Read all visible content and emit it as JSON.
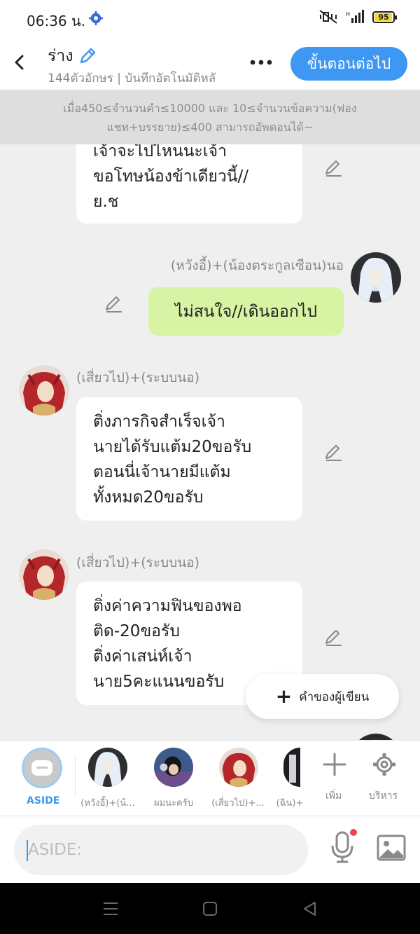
{
  "status_bar": {
    "time": "06:36 น.",
    "battery": "95",
    "battery_level": 0.95
  },
  "header": {
    "title": "ร่าง",
    "subtitle": "144ตัวอักษร | บันทึกอัตโนมัติหลั",
    "next_button": "ขั้นตอนต่อไป"
  },
  "notice": {
    "line1": "เมื่อ450≤จำนวนคำ≤10000 และ 10≤จำนวนข้อความ(ฟอง",
    "line2": "แชท+บรรยาย)≤400 สามารถอัพตอนได้~"
  },
  "messages": [
    {
      "lines": [
        "เจ้าจะไปไหนนะเจ้า",
        "ขอโทษน้องข้าเดียวนี้//",
        "ย.ช"
      ]
    },
    {
      "name": "(หวังอี้)+(น้องตระกูลเซือน)นอ",
      "text": "ไม่สนใจ//เดินออกไป"
    },
    {
      "name": "(เสี่ยวไป)+(ระบบนอ)",
      "lines": [
        "ติ่งภารกิจสำเร็จเจ้า",
        "นายได้รับแต้ม20ขอรับ",
        "ตอนนี่เจ้านายมีแต้ม",
        "ทั้งหมด20ขอรับ"
      ]
    },
    {
      "name": "(เสี่ยวไป)+(ระบบนอ)",
      "lines": [
        "ติ่งค่าความฟินของพอ",
        "ติด-20ขอรับ",
        "ติ่งค่าเสน่ห์เจ้า",
        "นาย5คะแนนขอรับ"
      ]
    }
  ],
  "fab": {
    "label": "คำของผู้เขียน"
  },
  "characters": {
    "aside": "ASIDE",
    "items": [
      {
        "label": "(หวังอี้)+(น้..."
      },
      {
        "label": "ผมนะครับ"
      },
      {
        "label": "(เสี่ยวไป)+..."
      },
      {
        "label": "(ฉิน)+"
      }
    ],
    "add": "เพิ่ม",
    "manage": "บริหาร"
  },
  "input": {
    "placeholder": "ASIDE:"
  },
  "colors": {
    "accent": "#3e97f2",
    "green_bubble": "#d6f4a3",
    "background": "#efefef"
  }
}
